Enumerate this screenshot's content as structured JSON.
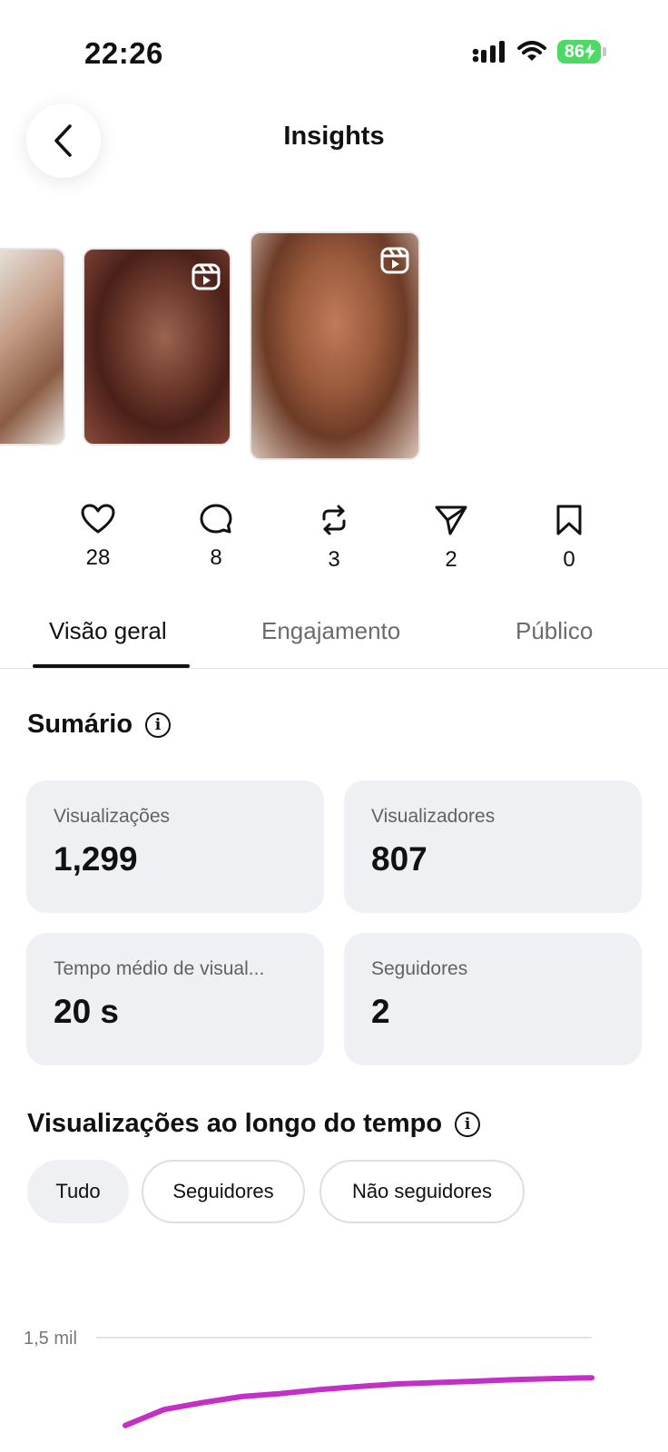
{
  "status": {
    "time": "22:26",
    "battery": "86"
  },
  "header": {
    "title": "Insights"
  },
  "post_stats": {
    "likes": "28",
    "comments": "8",
    "reposts": "3",
    "shares": "2",
    "saves": "0"
  },
  "tabs": [
    {
      "label": "Visão geral",
      "active": true
    },
    {
      "label": "Engajamento",
      "active": false
    },
    {
      "label": "Público",
      "active": false
    }
  ],
  "summary": {
    "title": "Sumário",
    "cards": [
      {
        "label": "Visualizações",
        "value": "1,299"
      },
      {
        "label": "Visualizadores",
        "value": "807"
      },
      {
        "label": "Tempo médio de visual...",
        "value": "20 s"
      },
      {
        "label": "Seguidores",
        "value": "2"
      }
    ]
  },
  "views_over_time": {
    "title": "Visualizações ao longo do tempo",
    "filters": [
      {
        "label": "Tudo",
        "active": true
      },
      {
        "label": "Seguidores",
        "active": false
      },
      {
        "label": "Não seguidores",
        "active": false
      }
    ]
  },
  "chart_data": {
    "type": "line",
    "y_tick_labels": [
      "1,5 mil"
    ],
    "ylim": [
      0,
      1500
    ],
    "series": [
      {
        "values": [
          1060,
          1140,
          1175,
          1205,
          1220,
          1240,
          1255,
          1268,
          1275,
          1282,
          1290,
          1295,
          1299
        ]
      }
    ],
    "line_color": "#c32fc7",
    "grid": true
  },
  "colors": {
    "card_bg": "#eff0f4",
    "chart_line": "#c32fc7",
    "battery": "#4cd964"
  }
}
